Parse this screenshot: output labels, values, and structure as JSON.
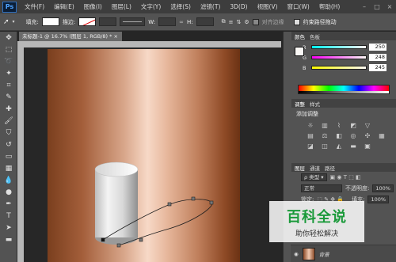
{
  "app": {
    "logo": "Ps"
  },
  "menu": [
    "文件(F)",
    "编辑(E)",
    "图像(I)",
    "图层(L)",
    "文字(Y)",
    "选择(S)",
    "滤镜(T)",
    "3D(D)",
    "视图(V)",
    "窗口(W)",
    "帮助(H)"
  ],
  "window_controls": [
    "–",
    "□",
    "×"
  ],
  "options_bar": {
    "fill_label": "填充:",
    "stroke_label": "描边:",
    "w_label": "W:",
    "h_label": "H:",
    "align_edges": "对齐边缘",
    "constrain_path": "约束路径拖动"
  },
  "document": {
    "tab_title": "未标题-1 @ 16.7% (图层 1, RGB/8) *  ×"
  },
  "color_panel": {
    "tabs": [
      "颜色",
      "色板"
    ],
    "channels": [
      {
        "label": "R",
        "value": "250"
      },
      {
        "label": "G",
        "value": "248"
      },
      {
        "label": "B",
        "value": "245"
      }
    ]
  },
  "adjust_panel": {
    "tabs": [
      "调整",
      "样式"
    ],
    "title": "添加调整",
    "icons": [
      "brightness-icon",
      "levels-icon",
      "curves-icon",
      "exposure-icon",
      "vibrance-icon",
      "hue-icon",
      "balance-icon",
      "bw-icon",
      "photo-filter-icon",
      "channel-mixer-icon",
      "lookup-icon",
      "invert-icon",
      "posterize-icon",
      "threshold-icon",
      "gradient-map-icon",
      "selective-color-icon"
    ]
  },
  "layers_panel": {
    "tabs": [
      "图层",
      "通道",
      "路径"
    ],
    "filter": "类型",
    "blend_mode": "正常",
    "opacity_label": "不透明度:",
    "opacity_value": "100%",
    "lock_label": "锁定:",
    "fill_label": "填充:",
    "fill_value": "100%",
    "layers": [
      {
        "name": "背景"
      }
    ]
  },
  "watermark": {
    "main": "百科全说",
    "sub": "助你轻松解决"
  },
  "colors": {
    "accent": "#1a9a3a"
  }
}
